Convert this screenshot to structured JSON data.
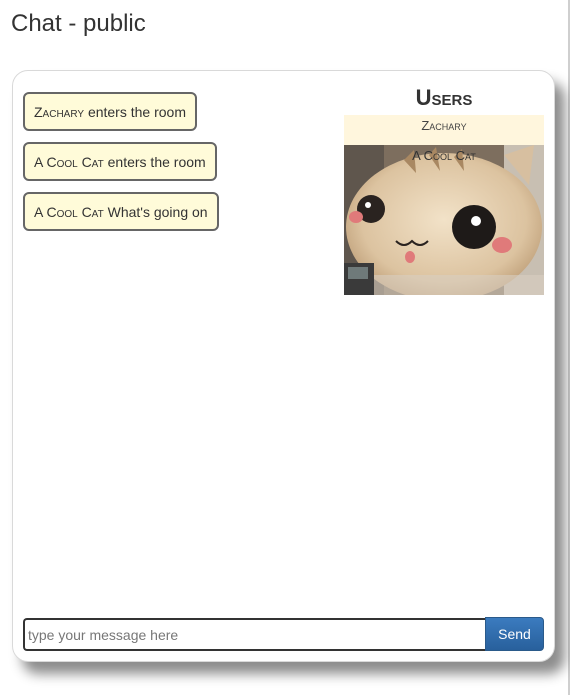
{
  "page": {
    "title": "Chat - public"
  },
  "messages": [
    {
      "user": "Zachary",
      "text": "enters the room"
    },
    {
      "user": "A Cool Cat",
      "text": "enters the room"
    },
    {
      "user": "A Cool Cat",
      "text": "What's going on"
    }
  ],
  "users": {
    "title": "Users",
    "list": [
      {
        "name": "Zachary",
        "avatar": null
      },
      {
        "name": "A Cool Cat",
        "avatar": "plush-cat-photo"
      }
    ]
  },
  "composer": {
    "placeholder": "type your message here",
    "send_label": "Send"
  },
  "colors": {
    "message_bg": "#fffbd9",
    "user_row_bg": "#fff6dd",
    "send_button": "#3071a9"
  }
}
